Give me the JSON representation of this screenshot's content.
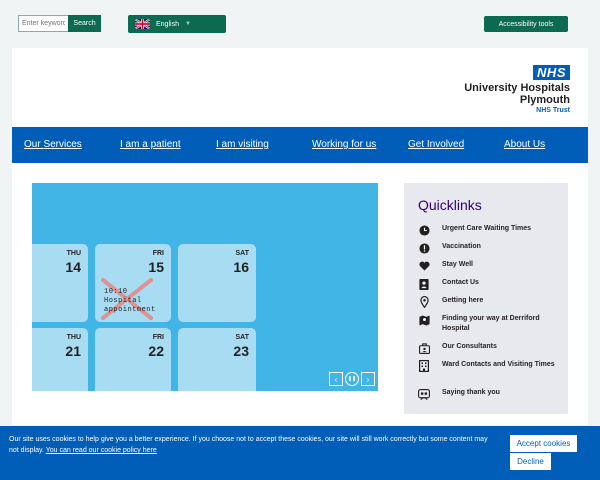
{
  "search": {
    "placeholder": "Enter keyword",
    "button_label": "Search"
  },
  "language": {
    "label": "English"
  },
  "accessibility": {
    "label": "Accessibility tools"
  },
  "logo": {
    "badge": "NHS",
    "line1": "University Hospitals",
    "line2": "Plymouth",
    "line3": "NHS Trust"
  },
  "nav": {
    "items": [
      {
        "label": "Our Services"
      },
      {
        "label": "I am a patient"
      },
      {
        "label": "I am visiting"
      },
      {
        "label": "Working for us"
      },
      {
        "label": "Get Involved"
      },
      {
        "label": "About Us"
      }
    ]
  },
  "carousel": {
    "calendar": [
      {
        "day": "THU",
        "date": "14"
      },
      {
        "day": "FRI",
        "date": "15"
      },
      {
        "day": "SAT",
        "date": "16"
      },
      {
        "day": "THU",
        "date": "21"
      },
      {
        "day": "FRI",
        "date": "22"
      },
      {
        "day": "SAT",
        "date": "23"
      }
    ],
    "appointment": {
      "time": "10:10",
      "line2": "Hospital",
      "line3": "appointment"
    },
    "controls": {
      "prev": "‹",
      "pause": "❚❚",
      "next": "›"
    }
  },
  "quicklinks": {
    "title": "Quicklinks",
    "items": [
      {
        "label": "Urgent Care Waiting Times",
        "icon": "clock-icon"
      },
      {
        "label": "Vaccination",
        "icon": "alert-icon"
      },
      {
        "label": "Stay Well",
        "icon": "heart-icon"
      },
      {
        "label": "Contact Us",
        "icon": "contact-icon"
      },
      {
        "label": "Getting here",
        "icon": "map-pin-icon"
      },
      {
        "label": "Finding your way at Derriford Hospital",
        "icon": "map-icon"
      },
      {
        "label": "Our Consultants",
        "icon": "consultants-icon"
      },
      {
        "label": "Ward Contacts and Visiting Times",
        "icon": "building-icon"
      },
      {
        "label": "Saying thank you",
        "icon": "thanks-icon"
      }
    ]
  },
  "cookie": {
    "text": "Our site uses cookies to help give you a better experience. If you choose not to accept these cookies, our site will still work correctly but some content may not display.",
    "link_text": "You can read our cookie policy here",
    "accept_label": "Accept cookies",
    "decline_label": "Decline"
  },
  "colors": {
    "nhs_blue": "#005eb8",
    "nhs_green": "#0b6a4f",
    "carousel_blue": "#41b6e6",
    "quicklinks_title": "#330072",
    "page_background": "#f0f4f5"
  }
}
